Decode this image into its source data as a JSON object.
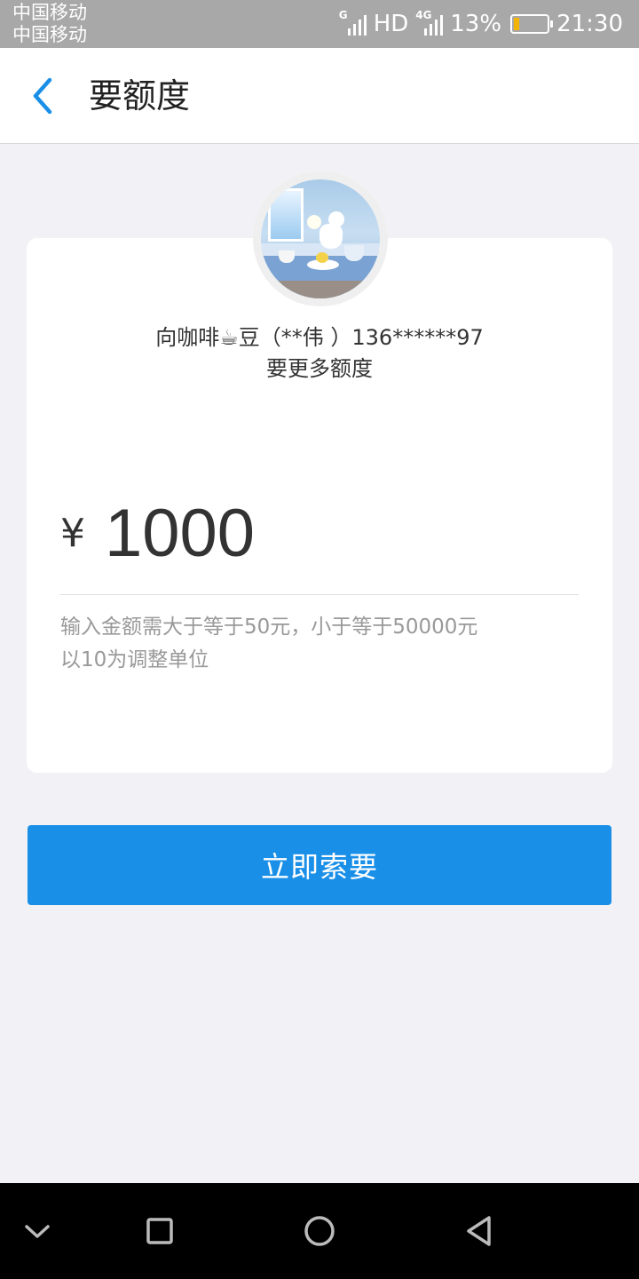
{
  "status_bar": {
    "carrier_1": "中国移动",
    "carrier_2": "中国移动",
    "network_1": "G",
    "hd": "HD",
    "network_2": "4G",
    "battery_percent": "13%",
    "battery_level": 0.13,
    "time": "21:30"
  },
  "header": {
    "title": "要额度",
    "back_icon": "chevron-left-icon"
  },
  "request": {
    "avatar": "avatar-image",
    "requester_line": "向咖啡☕豆（**伟 ）136******97",
    "subtitle": "要更多额度"
  },
  "amount": {
    "currency": "¥",
    "value": "1000"
  },
  "hint": {
    "line1": "输入金额需大于等于50元，小于等于50000元",
    "line2": "以10为调整单位"
  },
  "submit_label": "立即索要",
  "nav": {
    "hide": "chevron-down-icon",
    "recents": "square-icon",
    "home": "circle-icon",
    "back": "triangle-back-icon"
  },
  "colors": {
    "accent": "#1a8fe8",
    "background": "#f2f2f6"
  }
}
